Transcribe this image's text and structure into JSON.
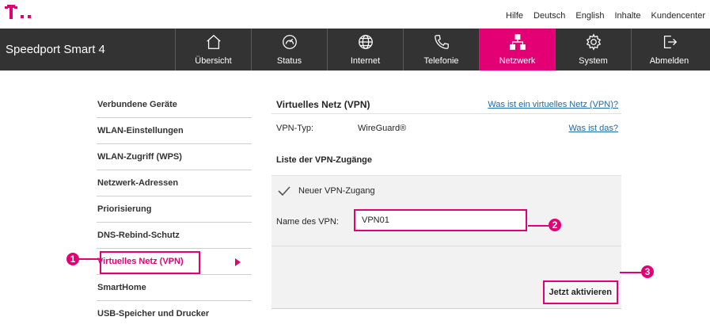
{
  "colors": {
    "brand": "#e20074",
    "navbar": "#333333",
    "link": "#1f6aa5"
  },
  "topbar": {
    "logo_icon": "telekom-t-logo",
    "links": [
      "Hilfe",
      "Deutsch",
      "English",
      "Inhalte",
      "Kundencenter"
    ]
  },
  "navbar": {
    "brand": "Speedport Smart 4",
    "items": [
      {
        "label": "Übersicht",
        "icon": "house-icon"
      },
      {
        "label": "Status",
        "icon": "gauge-icon"
      },
      {
        "label": "Internet",
        "icon": "globe-icon"
      },
      {
        "label": "Telefonie",
        "icon": "phone-icon"
      },
      {
        "label": "Netzwerk",
        "icon": "network-icon",
        "active": true
      },
      {
        "label": "System",
        "icon": "gear-icon"
      },
      {
        "label": "Abmelden",
        "icon": "logout-icon"
      }
    ]
  },
  "sidebar": {
    "items": [
      {
        "label": "Verbundene Geräte"
      },
      {
        "label": "WLAN-Einstellungen"
      },
      {
        "label": "WLAN-Zugriff (WPS)"
      },
      {
        "label": "Netzwerk-Adressen"
      },
      {
        "label": "Priorisierung"
      },
      {
        "label": "DNS-Rebind-Schutz"
      },
      {
        "label": "Virtuelles Netz (VPN)",
        "active": true
      },
      {
        "label": "SmartHome"
      },
      {
        "label": "USB-Speicher und Drucker"
      }
    ]
  },
  "main": {
    "title": "Virtuelles Netz (VPN)",
    "help_link": "Was ist ein virtuelles Netz (VPN)?",
    "vpn_type_label": "VPN-Typ:",
    "vpn_type_value": "WireGuard®",
    "vpn_type_link": "Was ist das?",
    "list_heading": "Liste der VPN-Zugänge",
    "new_entry": "Neuer VPN-Zugang",
    "name_label": "Name des VPN:",
    "name_value": "VPN01",
    "activate_button": "Jetzt aktivieren"
  },
  "callouts": [
    "1",
    "2",
    "3"
  ]
}
